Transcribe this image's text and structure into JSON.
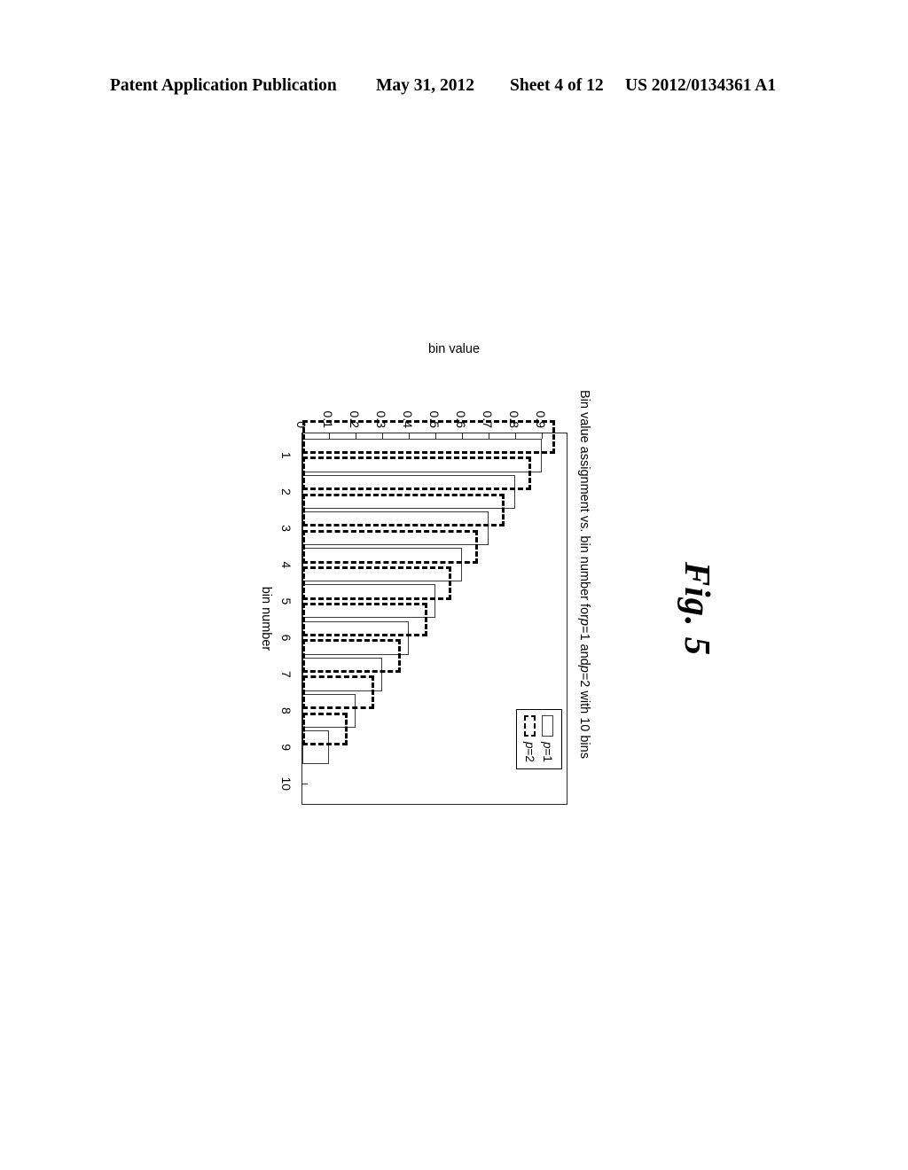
{
  "header": {
    "publication": "Patent Application Publication",
    "date": "May 31, 2012",
    "sheet": "Sheet 4 of 12",
    "number": "US 2012/0134361 A1"
  },
  "figure": {
    "caption": "Fig. 5"
  },
  "chart_data": {
    "type": "bar",
    "orientation": "vertical",
    "title": "Bin value assignment vs. bin number for p=1 and p=2 with 10 bins",
    "title_parts": {
      "lead": "Bin value assignment vs. bin number for ",
      "p1_italic": "p",
      "p1_rest": "=1 and ",
      "p2_italic": "p",
      "p2_rest": "=2 with 10 bins"
    },
    "xlabel": "bin number",
    "ylabel": "bin value",
    "categories": [
      "1",
      "2",
      "3",
      "4",
      "5",
      "6",
      "7",
      "8",
      "9",
      "10"
    ],
    "x": [
      1,
      2,
      3,
      4,
      5,
      6,
      7,
      8,
      9,
      10
    ],
    "ylim": [
      0,
      1.0
    ],
    "xlim": [
      0.4,
      10.6
    ],
    "yticks": [
      0,
      0.1,
      0.2,
      0.3,
      0.4,
      0.5,
      0.6,
      0.7,
      0.8,
      0.9
    ],
    "ytick_labels": [
      "0",
      "0.1",
      "0.2",
      "0.3",
      "0.4",
      "0.5",
      "0.6",
      "0.7",
      "0.8",
      "0.9"
    ],
    "grid": false,
    "legend_position": "upper right",
    "series": [
      {
        "name": "p=1",
        "name_italic_prefix": "p",
        "name_rest": "=1",
        "style": "solid",
        "values": [
          0.9,
          0.8,
          0.7,
          0.6,
          0.5,
          0.4,
          0.3,
          0.2,
          0.1,
          0.0
        ]
      },
      {
        "name": "p=2",
        "name_italic_prefix": "p",
        "name_rest": "=2",
        "style": "dashed",
        "values": [
          0.95,
          0.86,
          0.76,
          0.66,
          0.56,
          0.47,
          0.37,
          0.27,
          0.17,
          0.0
        ]
      }
    ]
  }
}
